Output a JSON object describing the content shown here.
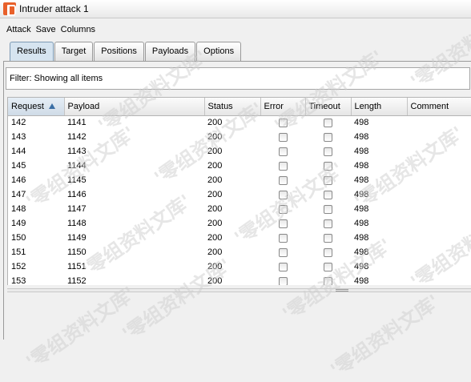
{
  "window": {
    "title": "Intruder attack 1"
  },
  "menu": [
    "Attack",
    "Save",
    "Columns"
  ],
  "tabs": [
    {
      "label": "Results",
      "active": true
    },
    {
      "label": "Target",
      "active": false
    },
    {
      "label": "Positions",
      "active": false
    },
    {
      "label": "Payloads",
      "active": false
    },
    {
      "label": "Options",
      "active": false
    }
  ],
  "filter": {
    "text": "Filter:  Showing all items"
  },
  "table": {
    "sorted_column": "Request",
    "sort_direction": "ascending",
    "columns": [
      "Request",
      "Payload",
      "Status",
      "Error",
      "Timeout",
      "Length",
      "Comment"
    ],
    "rows": [
      {
        "request": "142",
        "payload": "1141",
        "status": "200",
        "error": false,
        "timeout": false,
        "length": "498",
        "comment": ""
      },
      {
        "request": "143",
        "payload": "1142",
        "status": "200",
        "error": false,
        "timeout": false,
        "length": "498",
        "comment": ""
      },
      {
        "request": "144",
        "payload": "1143",
        "status": "200",
        "error": false,
        "timeout": false,
        "length": "498",
        "comment": ""
      },
      {
        "request": "145",
        "payload": "1144",
        "status": "200",
        "error": false,
        "timeout": false,
        "length": "498",
        "comment": ""
      },
      {
        "request": "146",
        "payload": "1145",
        "status": "200",
        "error": false,
        "timeout": false,
        "length": "498",
        "comment": ""
      },
      {
        "request": "147",
        "payload": "1146",
        "status": "200",
        "error": false,
        "timeout": false,
        "length": "498",
        "comment": ""
      },
      {
        "request": "148",
        "payload": "1147",
        "status": "200",
        "error": false,
        "timeout": false,
        "length": "498",
        "comment": ""
      },
      {
        "request": "149",
        "payload": "1148",
        "status": "200",
        "error": false,
        "timeout": false,
        "length": "498",
        "comment": ""
      },
      {
        "request": "150",
        "payload": "1149",
        "status": "200",
        "error": false,
        "timeout": false,
        "length": "498",
        "comment": ""
      },
      {
        "request": "151",
        "payload": "1150",
        "status": "200",
        "error": false,
        "timeout": false,
        "length": "498",
        "comment": ""
      },
      {
        "request": "152",
        "payload": "1151",
        "status": "200",
        "error": false,
        "timeout": false,
        "length": "498",
        "comment": ""
      },
      {
        "request": "153",
        "payload": "1152",
        "status": "200",
        "error": false,
        "timeout": false,
        "length": "498",
        "comment": ""
      }
    ]
  },
  "watermark": "'零组资料文库'",
  "icons": {
    "app": "burp-logo-icon",
    "sort": "sort-ascending-icon"
  }
}
